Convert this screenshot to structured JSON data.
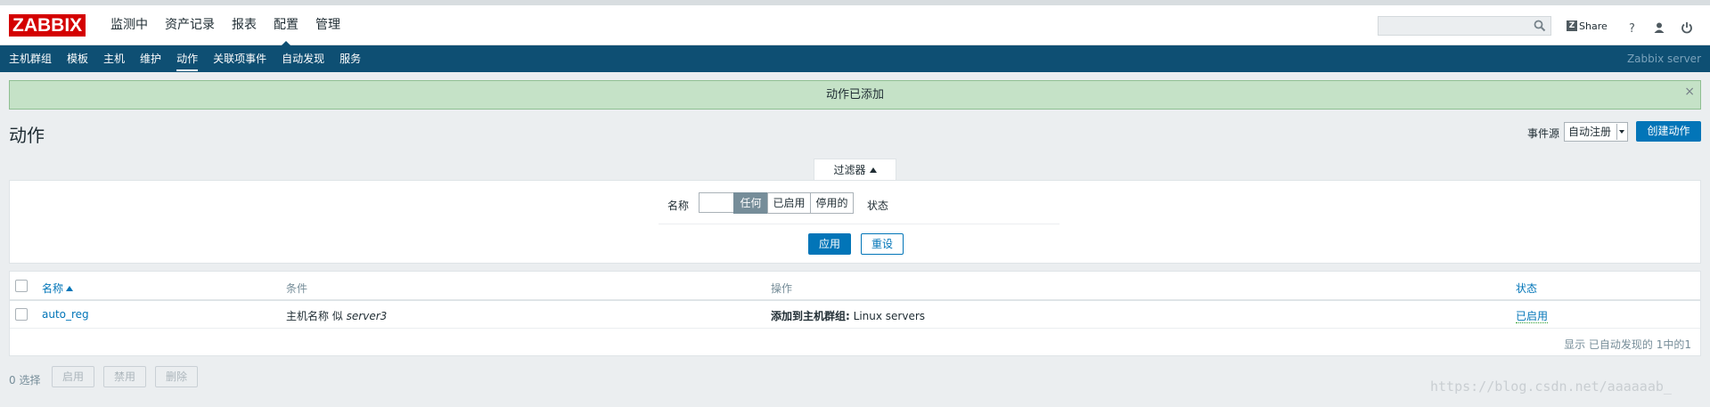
{
  "header": {
    "logo": "ZABBIX",
    "main_nav": [
      "监测中",
      "资产记录",
      "报表",
      "配置",
      "管理"
    ],
    "selected_main": "配置",
    "search_placeholder": "",
    "share_label": "Share",
    "icons": [
      "search-icon",
      "help-icon",
      "user-icon",
      "power-icon"
    ]
  },
  "sub_nav": {
    "items": [
      "主机群组",
      "模板",
      "主机",
      "维护",
      "动作",
      "关联项事件",
      "自动发现",
      "服务"
    ],
    "active": "动作",
    "server_name": "Zabbix server"
  },
  "message": {
    "text": "动作已添加",
    "close": "×"
  },
  "page": {
    "title": "动作",
    "event_source_label": "事件源",
    "event_source_value": "自动注册",
    "create_button": "创建动作"
  },
  "filter": {
    "tab_label": "过滤器",
    "name_label": "名称",
    "name_value": "",
    "status_label": "状态",
    "status_options": [
      "任何",
      "已启用",
      "停用的"
    ],
    "status_selected": "任何",
    "apply": "应用",
    "reset": "重设"
  },
  "table": {
    "columns": [
      "名称",
      "条件",
      "操作",
      "状态"
    ],
    "rows": [
      {
        "name": "auto_reg",
        "condition_prefix": "主机名称 似",
        "condition_value": "server3",
        "operation_label": "添加到主机群组:",
        "operation_value": "Linux servers",
        "status": "已启用"
      }
    ],
    "footer": "显示 已自动发现的 1中的1"
  },
  "actions": {
    "selected_count": "0 选择",
    "enable": "启用",
    "disable": "禁用",
    "delete": "删除"
  },
  "watermark": "https://blog.csdn.net/aaaaaab_",
  "colors": {
    "brand": "#d40000",
    "subnav": "#0e4f73",
    "primary": "#0275b8",
    "success_bg": "#c5e2c7",
    "enabled": "#2f9f2f"
  }
}
